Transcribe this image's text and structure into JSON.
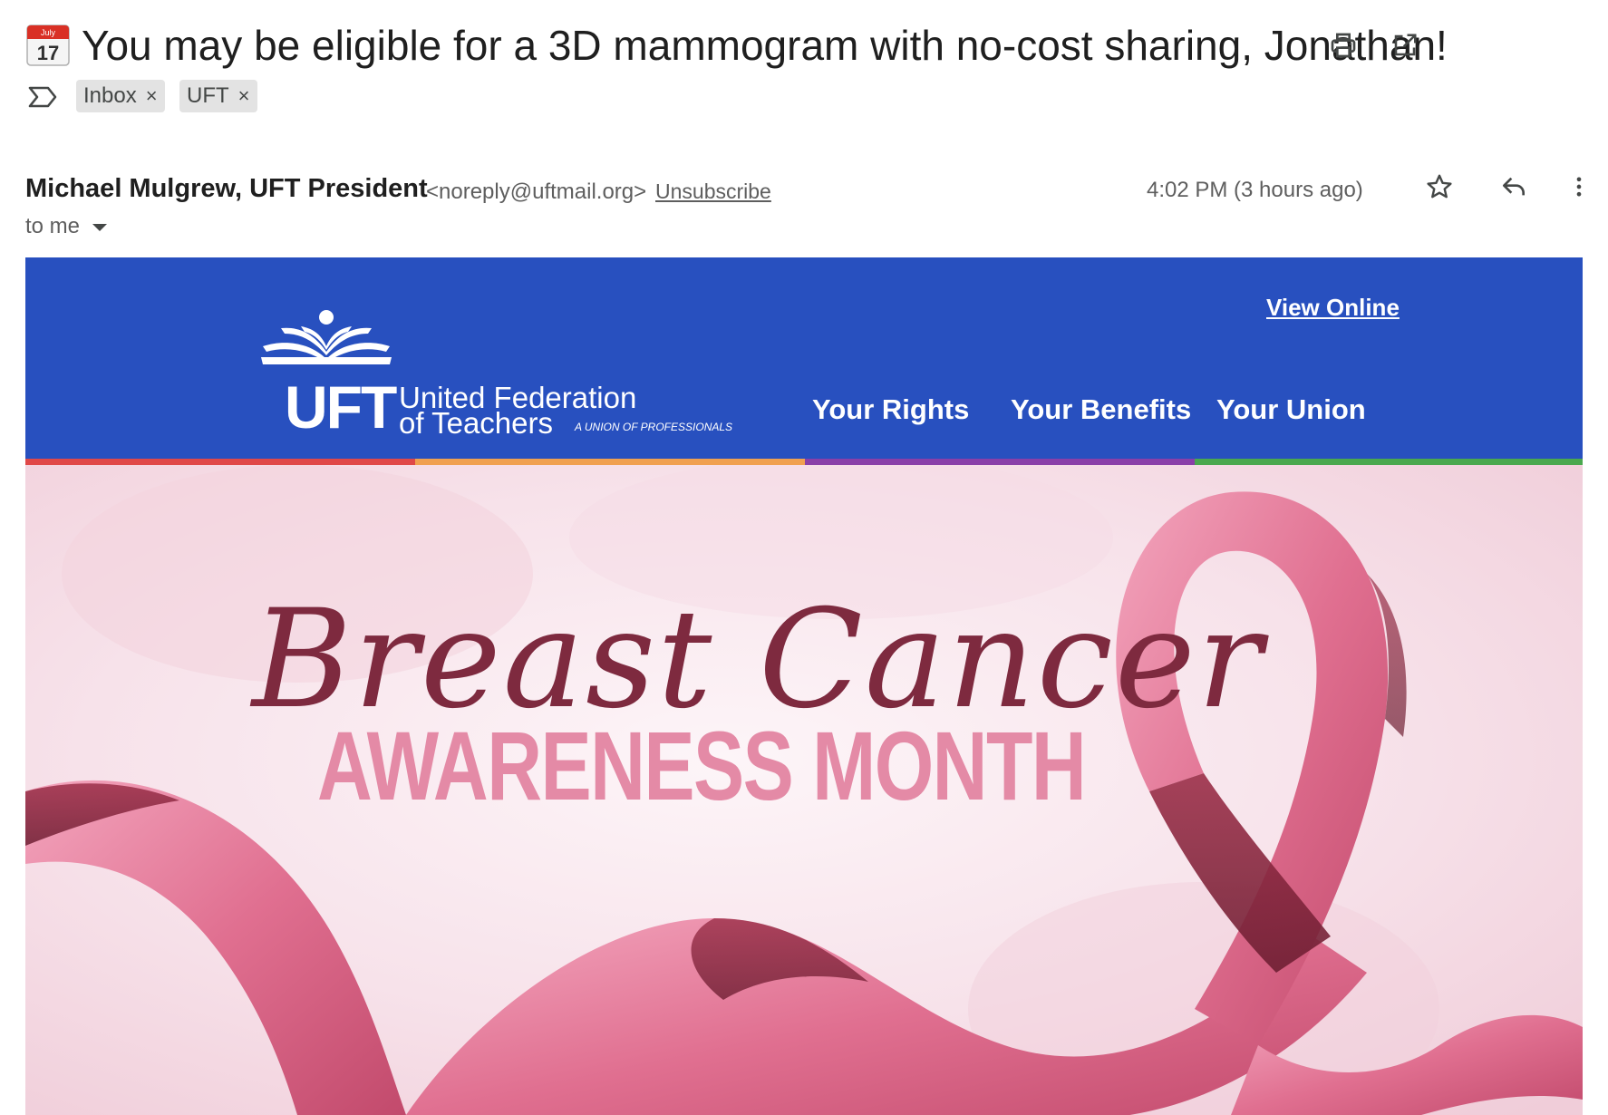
{
  "email": {
    "calendar_icon": {
      "month": "July",
      "day": "17"
    },
    "subject": "You may be eligible for a 3D mammogram with no-cost sharing, Jonathan!",
    "labels": [
      {
        "label": "Inbox",
        "remove": "×"
      },
      {
        "label": "UFT",
        "remove": "×"
      }
    ],
    "sender_name": "Michael Mulgrew, UFT President",
    "sender_email": "<noreply@uftmail.org>",
    "unsubscribe": "Unsubscribe",
    "timestamp": "4:02 PM (3 hours ago)",
    "to_me": "to me"
  },
  "newsletter": {
    "view_online": "View Online",
    "logo": {
      "letters": "UFT",
      "line1": "United Federation",
      "line2": "of Teachers",
      "tagline": "A UNION OF PROFESSIONALS"
    },
    "nav": [
      "Your Rights",
      "Your Benefits",
      "Your Union"
    ],
    "banner_color": "#2850bf",
    "stripe_colors": [
      "#e04848",
      "#f0a050",
      "#8a3fa8",
      "#4aa84e"
    ],
    "hero": {
      "script_title": "Breast Cancer",
      "caps_title": "AWARENESS MONTH",
      "ribbon_color": "#e06f90"
    }
  }
}
